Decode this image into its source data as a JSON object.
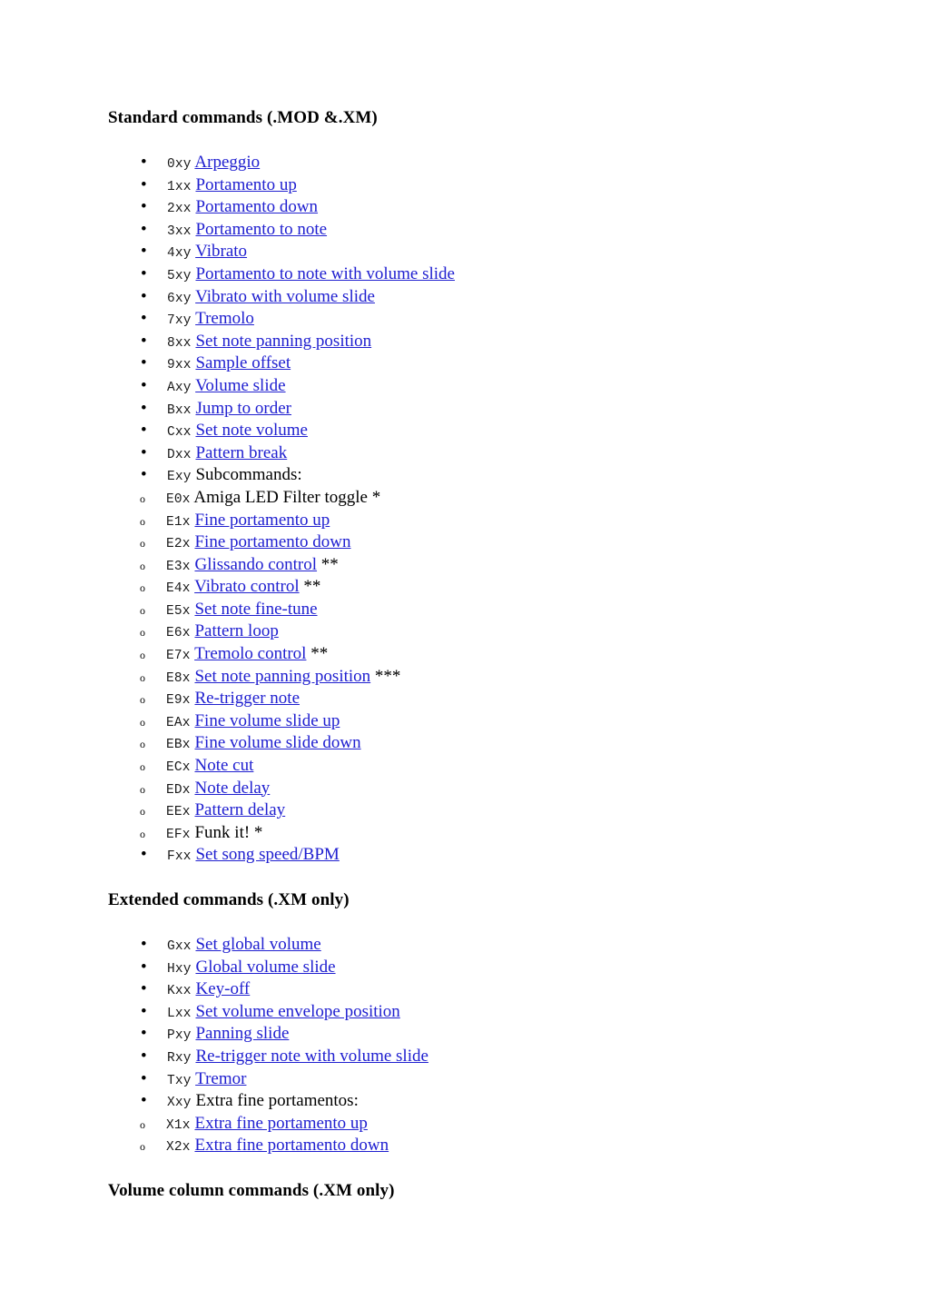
{
  "document": {
    "background_color": "#ffffff",
    "link_color": "#2020d0",
    "text_color": "#000000"
  },
  "sections": [
    {
      "heading": "Standard commands (.MOD &.XM)",
      "items": [
        {
          "code": "0xy",
          "label": "Arpeggio",
          "link": true
        },
        {
          "code": "1xx",
          "label": "Portamento up",
          "link": true
        },
        {
          "code": "2xx",
          "label": "Portamento down",
          "link": true
        },
        {
          "code": "3xx",
          "label": "Portamento to note",
          "link": true
        },
        {
          "code": "4xy",
          "label": "Vibrato",
          "link": true
        },
        {
          "code": "5xy",
          "label": "Portamento to note with volume slide",
          "link": true
        },
        {
          "code": "6xy",
          "label": "Vibrato with volume slide",
          "link": true
        },
        {
          "code": "7xy",
          "label": "Tremolo",
          "link": true
        },
        {
          "code": "8xx",
          "label": "Set note panning position",
          "link": true
        },
        {
          "code": "9xx",
          "label": "Sample offset",
          "link": true
        },
        {
          "code": "Axy",
          "label": "Volume slide",
          "link": true
        },
        {
          "code": "Bxx",
          "label": "Jump to order",
          "link": true
        },
        {
          "code": "Cxx",
          "label": "Set note volume",
          "link": true
        },
        {
          "code": "Dxx",
          "label": "Pattern break",
          "link": true
        },
        {
          "code": "Exy",
          "label": "Subcommands:",
          "link": false,
          "subitems": [
            {
              "code": "E0x",
              "label": "Amiga LED Filter toggle",
              "link": false,
              "note": "*"
            },
            {
              "code": "E1x",
              "label": "Fine portamento up",
              "link": true
            },
            {
              "code": "E2x",
              "label": "Fine portamento down",
              "link": true
            },
            {
              "code": "E3x",
              "label": "Glissando control",
              "link": true,
              "note": "**"
            },
            {
              "code": "E4x",
              "label": "Vibrato control",
              "link": true,
              "note": "**"
            },
            {
              "code": "E5x",
              "label": "Set note fine-tune",
              "link": true
            },
            {
              "code": "E6x",
              "label": "Pattern loop",
              "link": true
            },
            {
              "code": "E7x",
              "label": "Tremolo control",
              "link": true,
              "note": "**"
            },
            {
              "code": "E8x",
              "label": "Set note panning position",
              "link": true,
              "note": "***"
            },
            {
              "code": "E9x",
              "label": "Re-trigger note",
              "link": true
            },
            {
              "code": "EAx",
              "label": "Fine volume slide up",
              "link": true
            },
            {
              "code": "EBx",
              "label": "Fine volume slide down",
              "link": true
            },
            {
              "code": "ECx",
              "label": "Note cut",
              "link": true
            },
            {
              "code": "EDx",
              "label": "Note delay",
              "link": true
            },
            {
              "code": "EEx",
              "label": "Pattern delay",
              "link": true
            },
            {
              "code": "EFx",
              "label": "Funk it!",
              "link": false,
              "note": "*"
            }
          ]
        },
        {
          "code": "Fxx",
          "label": "Set song speed/BPM",
          "link": true
        }
      ]
    },
    {
      "heading": "Extended commands (.XM only)",
      "items": [
        {
          "code": "Gxx",
          "label": "Set global volume",
          "link": true
        },
        {
          "code": "Hxy",
          "label": "Global volume slide",
          "link": true
        },
        {
          "code": "Kxx",
          "label": "Key-off",
          "link": true
        },
        {
          "code": "Lxx",
          "label": "Set volume envelope position",
          "link": true
        },
        {
          "code": "Pxy",
          "label": "Panning slide",
          "link": true
        },
        {
          "code": "Rxy",
          "label": "Re-trigger note with volume slide",
          "link": true
        },
        {
          "code": "Txy",
          "label": "Tremor",
          "link": true
        },
        {
          "code": "Xxy",
          "label": "Extra fine portamentos:",
          "link": false,
          "subitems": [
            {
              "code": "X1x",
              "label": "Extra fine portamento up",
              "link": true
            },
            {
              "code": "X2x",
              "label": "Extra fine portamento down",
              "link": true
            }
          ]
        }
      ]
    },
    {
      "heading": "Volume column commands (.XM only)",
      "items": []
    }
  ]
}
